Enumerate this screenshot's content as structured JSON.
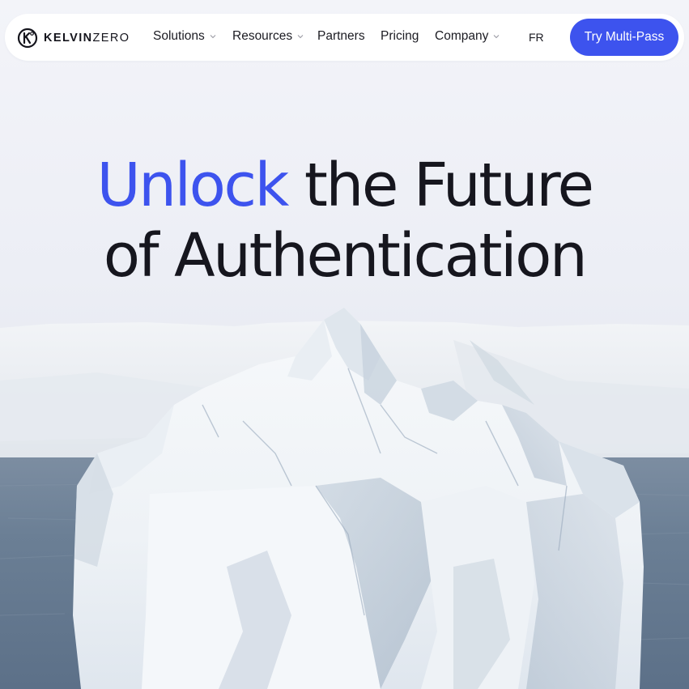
{
  "brand": {
    "name_bold": "KELVIN",
    "name_light": "ZERO"
  },
  "nav": {
    "items": [
      {
        "label": "Solutions",
        "dropdown": true
      },
      {
        "label": "Resources",
        "dropdown": true
      },
      {
        "label": "Partners",
        "dropdown": false
      },
      {
        "label": "Pricing",
        "dropdown": false
      },
      {
        "label": "Company",
        "dropdown": true
      }
    ],
    "language": "FR",
    "cta_label": "Try Multi-Pass"
  },
  "hero": {
    "headline_accent": "Unlock",
    "headline_rest_line1": "the Future",
    "headline_line2": "of Authentication",
    "image_subject": "iceberg in the ocean"
  },
  "colors": {
    "accent": "#3d53ee",
    "text": "#16161e",
    "background": "#eef0f6",
    "sea": "#6f8398"
  },
  "icons": {
    "chevron": "chevron-down-icon",
    "logo": "kelvinzero-logo-icon"
  }
}
